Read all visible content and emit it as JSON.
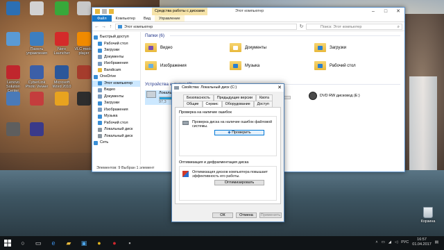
{
  "desktop_icons": [
    {
      "label": "",
      "color": "#2c6fb3"
    },
    {
      "label": "",
      "color": "#d2d2d2"
    },
    {
      "label": "",
      "color": "#38a83a"
    },
    {
      "label": "",
      "color": "#c8c8c8"
    },
    {
      "label": "",
      "color": "#5a9ad5"
    },
    {
      "label": "Панель управления",
      "color": "#3d7ebf"
    },
    {
      "label": "Nero Launcher",
      "color": "#d42a2a"
    },
    {
      "label": "VLC media player",
      "color": "#f08a00"
    },
    {
      "label": "Lenovo Solution Center",
      "color": "#c0262d"
    },
    {
      "label": "CyberLink Photo Viewer",
      "color": "#3b5fa8"
    },
    {
      "label": "Microsoft Word 2010",
      "color": "#2b579a"
    },
    {
      "label": "",
      "color": "#a53c2c"
    },
    {
      "label": "",
      "color": "#4a7ab8"
    },
    {
      "label": "",
      "color": "#c43d3d"
    },
    {
      "label": "",
      "color": "#e8a31f"
    },
    {
      "label": "",
      "color": "#2d2d2d"
    },
    {
      "label": "",
      "color": "#5e5e5e"
    },
    {
      "label": "",
      "color": "#3a3a8a"
    }
  ],
  "explorer": {
    "ctx_tab": "Средства работы с дисками",
    "title": "Этот компьютер",
    "ribbon": {
      "file": "Файл",
      "tabs": [
        "Компьютер",
        "Вид"
      ],
      "manage": "Управление"
    },
    "address": "Этот компьютер",
    "search_placeholder": "Поиск: Этот компьютер",
    "nav": [
      {
        "label": "Быстрый доступ",
        "color": "#3a8fd6"
      },
      {
        "label": "Рабочий стол",
        "color": "#3a8fd6"
      },
      {
        "label": "Загрузки",
        "color": "#3a8fd6"
      },
      {
        "label": "Документы",
        "color": "#7a9bbf"
      },
      {
        "label": "Изображения",
        "color": "#7a9bbf"
      },
      {
        "label": "Bandicam",
        "color": "#e8b93c"
      },
      {
        "label": "OneDrive",
        "color": "#3a8fd6"
      },
      {
        "label": "Этот компьютер",
        "color": "#3a8fd6"
      },
      {
        "label": "Видео",
        "color": "#7a9bbf"
      },
      {
        "label": "Документы",
        "color": "#7a9bbf"
      },
      {
        "label": "Загрузки",
        "color": "#3a8fd6"
      },
      {
        "label": "Изображения",
        "color": "#7a9bbf"
      },
      {
        "label": "Музыка",
        "color": "#3a8fd6"
      },
      {
        "label": "Рабочий стол",
        "color": "#3a8fd6"
      },
      {
        "label": "Локальный диск",
        "color": "#8a96a0"
      },
      {
        "label": "Локальный диск",
        "color": "#8a96a0"
      },
      {
        "label": "Сеть",
        "color": "#3a8fd6"
      }
    ],
    "folders_group": "Папки (6)",
    "folders": [
      {
        "label": "Видео",
        "badge": "#7a4fb0"
      },
      {
        "label": "Документы",
        "badge": "#ffffff"
      },
      {
        "label": "Загрузки",
        "badge": "#2a7fd0"
      },
      {
        "label": "Изображения",
        "badge": "#6ab0e0"
      },
      {
        "label": "Музыка",
        "badge": "#2a7fd0"
      },
      {
        "label": "Рабочий стол",
        "badge": "#2a7fd0"
      }
    ],
    "drives_group": "Устройства и диски (3)",
    "drives": [
      {
        "label": "Локальный диск (C:)",
        "info": "97,3",
        "fill": 0.55
      },
      {
        "label": "Локальный диск (D:)",
        "info": "",
        "fill": 0.2
      }
    ],
    "dvd": "DVD RW дисковод (E:)",
    "status": "Элементов: 9    Выбран 1 элемент"
  },
  "dialog": {
    "title": "Свойства: Локальный диск (C:)",
    "tabs_row1": [
      "Безопасность",
      "Предыдущие версии",
      "Квота"
    ],
    "tabs_row2": [
      "Общие",
      "Сервис",
      "Оборудование",
      "Доступ"
    ],
    "check_title": "Проверка на наличие ошибок",
    "check_text": "Проверка диска на наличие ошибок файловой системы.",
    "check_button": "Проверить",
    "opt_title": "Оптимизация и дефрагментация диска",
    "opt_text": "Оптимизация дисков компьютера повышает эффективность его работы.",
    "opt_button": "Оптимизировать",
    "ok": "ОК",
    "cancel": "Отмена",
    "apply": "Применить"
  },
  "taskbar": {
    "lang": "РУС",
    "time": "16:57",
    "date": "01.04.2017"
  },
  "recycle_bin": "Корзина"
}
